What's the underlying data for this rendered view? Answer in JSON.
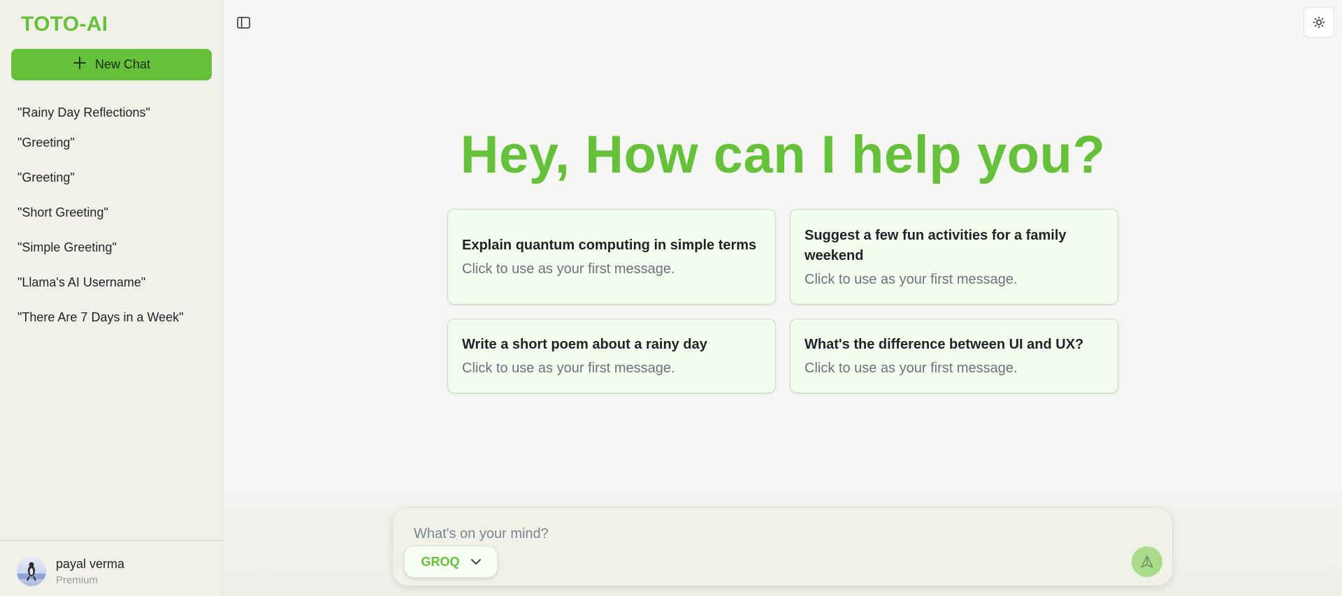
{
  "sidebar": {
    "brand": "TOTO-AI",
    "new_chat_label": "New Chat",
    "history": [
      "\"Rainy Day Reflections\"",
      "\"Greeting\"",
      "\"Greeting\"",
      "\"Short Greeting\"",
      "\"Simple Greeting\"",
      "\"Llama's AI Username\"",
      "\"There Are 7 Days in a Week\""
    ],
    "user": {
      "name": "payal verma",
      "plan": "Premium"
    }
  },
  "topbar": {
    "sidebar_toggle_icon": "sidebar-panel-icon",
    "theme_toggle_icon": "sun-icon"
  },
  "main": {
    "headline": "Hey, How can I help you?",
    "suggestions": [
      {
        "title": "Explain quantum computing in simple terms",
        "subtitle": "Click to use as your first message."
      },
      {
        "title": "Suggest a few fun activities for a family weekend",
        "subtitle": "Click to use as your first message."
      },
      {
        "title": "Write a short poem about a rainy day",
        "subtitle": "Click to use as your first message."
      },
      {
        "title": "What's the difference between UI and UX?",
        "subtitle": "Click to use as your first message."
      }
    ]
  },
  "composer": {
    "placeholder": "What's on your mind?",
    "value": "",
    "model": "GROQ",
    "send_icon": "send-arrow-icon"
  },
  "colors": {
    "accent": "#66c13a",
    "sidebar_bg": "#f1f1ea",
    "card_bg": "#f3fded",
    "send_disabled": "#a8dc8a"
  }
}
